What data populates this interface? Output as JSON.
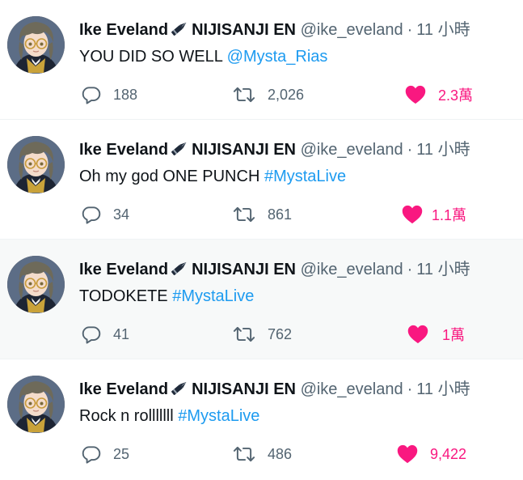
{
  "colors": {
    "text": "#0f1419",
    "secondary": "#536471",
    "link": "#1d9bf0",
    "like": "#f91880",
    "divider": "#eff3f4"
  },
  "icons": {
    "reply": "reply-icon",
    "retweet": "retweet-icon",
    "like": "heart-icon",
    "name_decoration": "pen-nib-icon"
  },
  "tweets": [
    {
      "display_name": "Ike Eveland",
      "name_suffix": "NIJISANJI EN",
      "handle": "@ike_eveland",
      "separator": "·",
      "time": "11 小時",
      "text": "YOU DID SO WELL ",
      "link": "@Mysta_Rias",
      "replies": "188",
      "retweets": "2,026",
      "likes": "2.3萬"
    },
    {
      "display_name": "Ike Eveland",
      "name_suffix": "NIJISANJI EN",
      "handle": "@ike_eveland",
      "separator": "·",
      "time": "11 小時",
      "text": "Oh my god ONE PUNCH ",
      "link": "#MystaLive",
      "replies": "34",
      "retweets": "861",
      "likes": "1.1萬"
    },
    {
      "display_name": "Ike Eveland",
      "name_suffix": "NIJISANJI EN",
      "handle": "@ike_eveland",
      "separator": "·",
      "time": "11 小時",
      "text": "TODOKETE ",
      "link": "#MystaLive",
      "replies": "41",
      "retweets": "762",
      "likes": "1萬"
    },
    {
      "display_name": "Ike Eveland",
      "name_suffix": "NIJISANJI EN",
      "handle": "@ike_eveland",
      "separator": "·",
      "time": "11 小時",
      "text": "Rock n rolllllll ",
      "link": "#MystaLive",
      "replies": "25",
      "retweets": "486",
      "likes": "9,422"
    }
  ]
}
